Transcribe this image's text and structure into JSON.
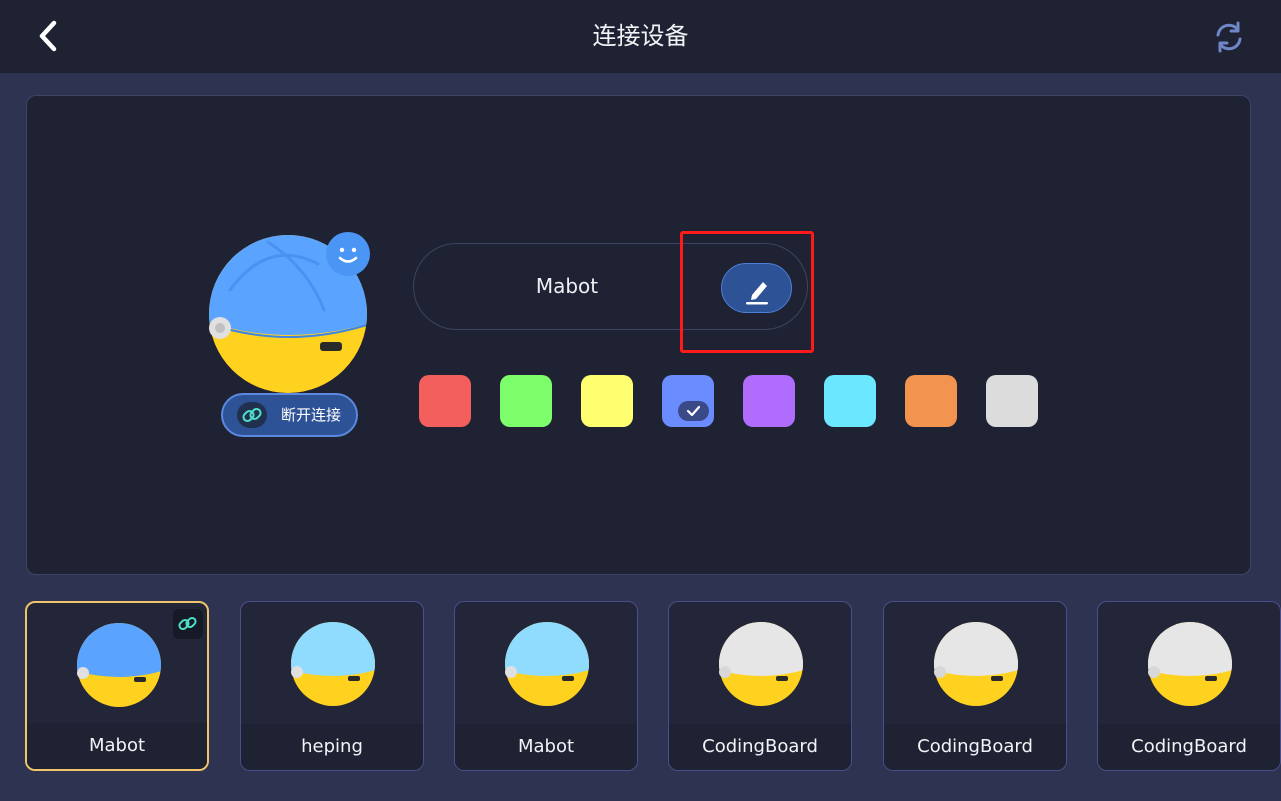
{
  "header": {
    "title": "连接设备",
    "back_icon": "chevron-left-icon",
    "refresh_icon": "refresh-icon"
  },
  "device": {
    "name": "Mabot",
    "disconnect_label": "断开连接",
    "status_icon": "smiley-icon",
    "edit_icon": "pencil-icon"
  },
  "colors": {
    "swatches": [
      "#f25f5c",
      "#7dff6b",
      "#ffff70",
      "#6b8cff",
      "#b06bff",
      "#6be7ff",
      "#f2944f",
      "#dcdcdc"
    ],
    "selected": "#6b8cff"
  },
  "devices": [
    {
      "name": "Mabot",
      "top_color": "#5aa4ff",
      "selected": true
    },
    {
      "name": "heping",
      "top_color": "#8fdcff",
      "selected": false
    },
    {
      "name": "Mabot",
      "top_color": "#8fdcff",
      "selected": false
    },
    {
      "name": "CodingBoard",
      "top_color": "#e6e6e6",
      "selected": false
    },
    {
      "name": "CodingBoard",
      "top_color": "#e6e6e6",
      "selected": false
    },
    {
      "name": "CodingBoard",
      "top_color": "#e6e6e6",
      "selected": false
    }
  ],
  "theme": {
    "background": "#2d3350",
    "panel": "#1f2232",
    "accent": "#2e5296",
    "highlight": "#ff1a1a",
    "selected_border": "#f0c46a",
    "robot_bottom": "#ffd21f"
  }
}
